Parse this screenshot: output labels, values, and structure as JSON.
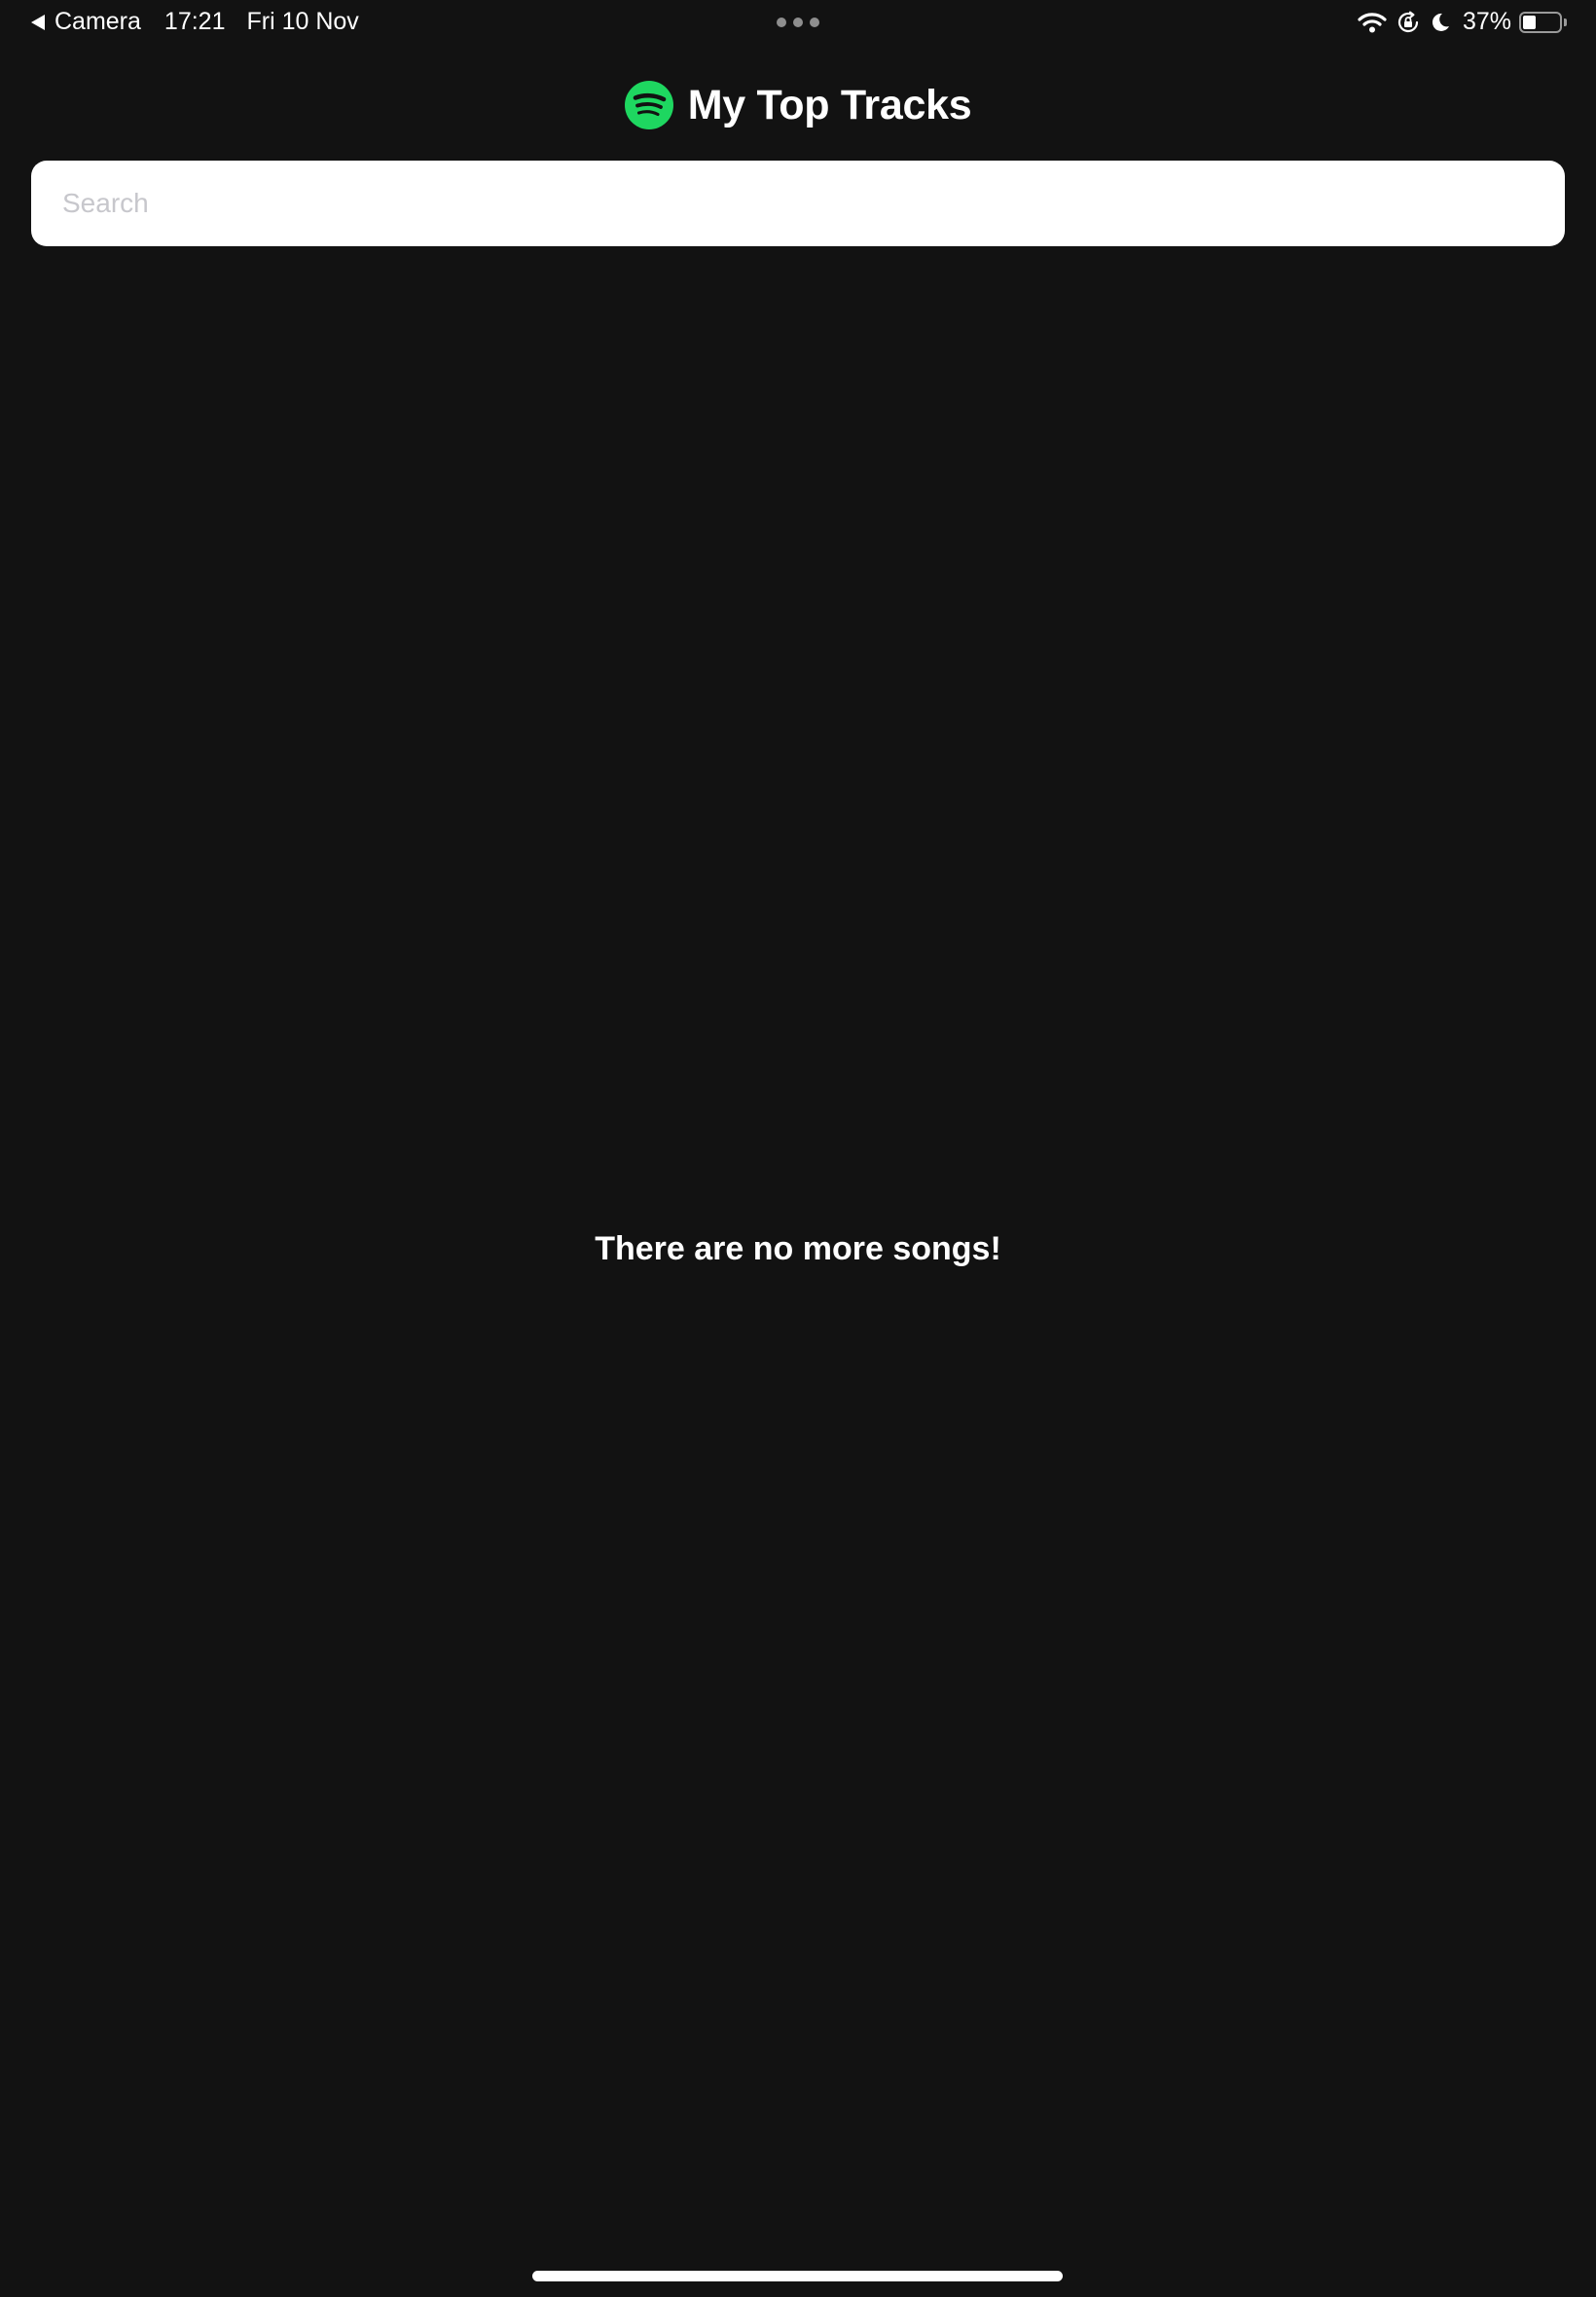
{
  "status_bar": {
    "back_label": "Camera",
    "time": "17:21",
    "date": "Fri 10 Nov",
    "battery_percent": "37%",
    "battery_level": 0.37,
    "icons": [
      "wifi-icon",
      "orientation-lock-icon",
      "moon-icon",
      "battery-icon"
    ]
  },
  "header": {
    "title": "My Top Tracks",
    "logo": "spotify-logo-icon",
    "brand_color": "#1ED760"
  },
  "search": {
    "placeholder": "Search",
    "value": ""
  },
  "content": {
    "empty_message": "There are no more songs!"
  },
  "theme": {
    "background": "#121212",
    "text": "#FFFFFF"
  }
}
